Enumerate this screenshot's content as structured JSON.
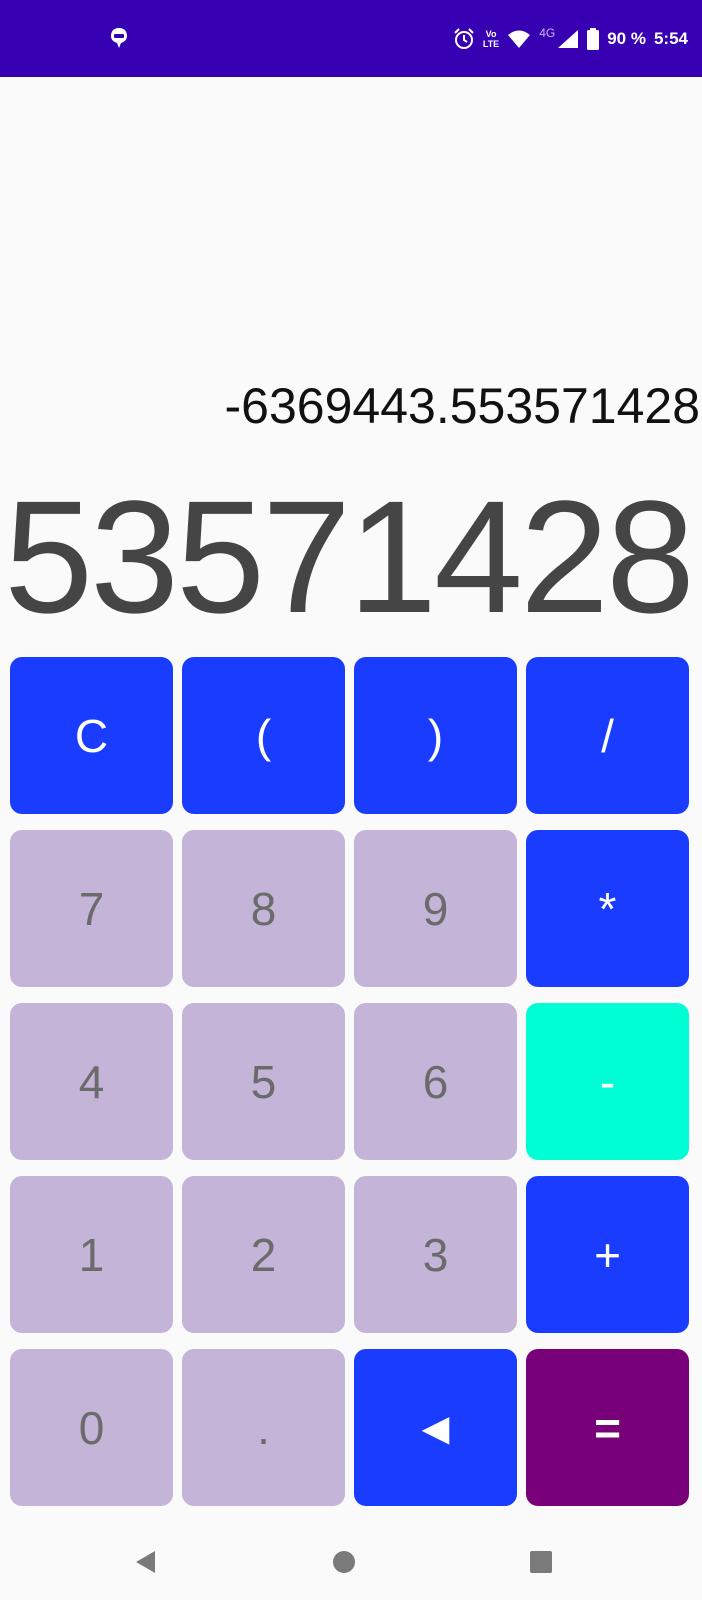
{
  "status_bar": {
    "battery": "90 %",
    "time": "5:54",
    "volte_top": "Vo",
    "volte_bottom": "LTE",
    "network": "4G",
    "icons": [
      "notification-icon",
      "alarm-icon",
      "volte-icon",
      "wifi-icon",
      "signal-icon",
      "battery-icon"
    ]
  },
  "display": {
    "expression": "-6369443.553571428",
    "result": "53571428"
  },
  "keypad": {
    "rows": [
      [
        {
          "label": "C",
          "kind": "op",
          "name": "clear-button"
        },
        {
          "label": "(",
          "kind": "op",
          "name": "open-paren-button"
        },
        {
          "label": ")",
          "kind": "op",
          "name": "close-paren-button"
        },
        {
          "label": "/",
          "kind": "op",
          "name": "divide-button"
        }
      ],
      [
        {
          "label": "7",
          "kind": "num",
          "name": "digit-7-button"
        },
        {
          "label": "8",
          "kind": "num",
          "name": "digit-8-button"
        },
        {
          "label": "9",
          "kind": "num",
          "name": "digit-9-button"
        },
        {
          "label": "*",
          "kind": "op",
          "name": "multiply-button"
        }
      ],
      [
        {
          "label": "4",
          "kind": "num",
          "name": "digit-4-button"
        },
        {
          "label": "5",
          "kind": "num",
          "name": "digit-5-button"
        },
        {
          "label": "6",
          "kind": "num",
          "name": "digit-6-button"
        },
        {
          "label": "-",
          "kind": "minus",
          "name": "subtract-button"
        }
      ],
      [
        {
          "label": "1",
          "kind": "num",
          "name": "digit-1-button"
        },
        {
          "label": "2",
          "kind": "num",
          "name": "digit-2-button"
        },
        {
          "label": "3",
          "kind": "num",
          "name": "digit-3-button"
        },
        {
          "label": "+",
          "kind": "op",
          "name": "add-button"
        }
      ],
      [
        {
          "label": "0",
          "kind": "num",
          "name": "digit-0-button"
        },
        {
          "label": ".",
          "kind": "num",
          "name": "decimal-button"
        },
        {
          "label": "◄",
          "kind": "op",
          "name": "backspace-button"
        },
        {
          "label": "=",
          "kind": "equals",
          "name": "equals-button"
        }
      ]
    ]
  },
  "colors": {
    "status_bar": "#3700b3",
    "operator": "#1a3cff",
    "number": "#c3b4d8",
    "minus": "#00ffd5",
    "equals": "#780078",
    "background": "#fafafa"
  },
  "navbar": {
    "icons": [
      "back-icon",
      "home-icon",
      "recents-icon"
    ]
  }
}
